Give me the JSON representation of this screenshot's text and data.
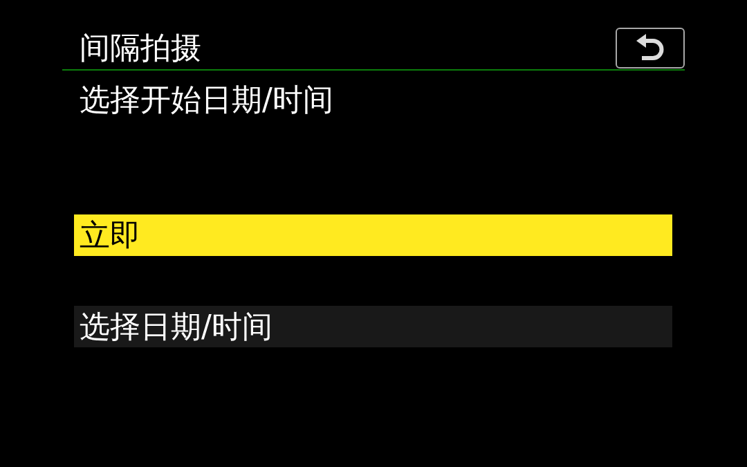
{
  "header": {
    "title": "间隔拍摄"
  },
  "subtitle": "选择开始日期/时间",
  "options": [
    {
      "label": "立即",
      "selected": true
    },
    {
      "label": "选择日期/时间",
      "selected": false
    }
  ]
}
